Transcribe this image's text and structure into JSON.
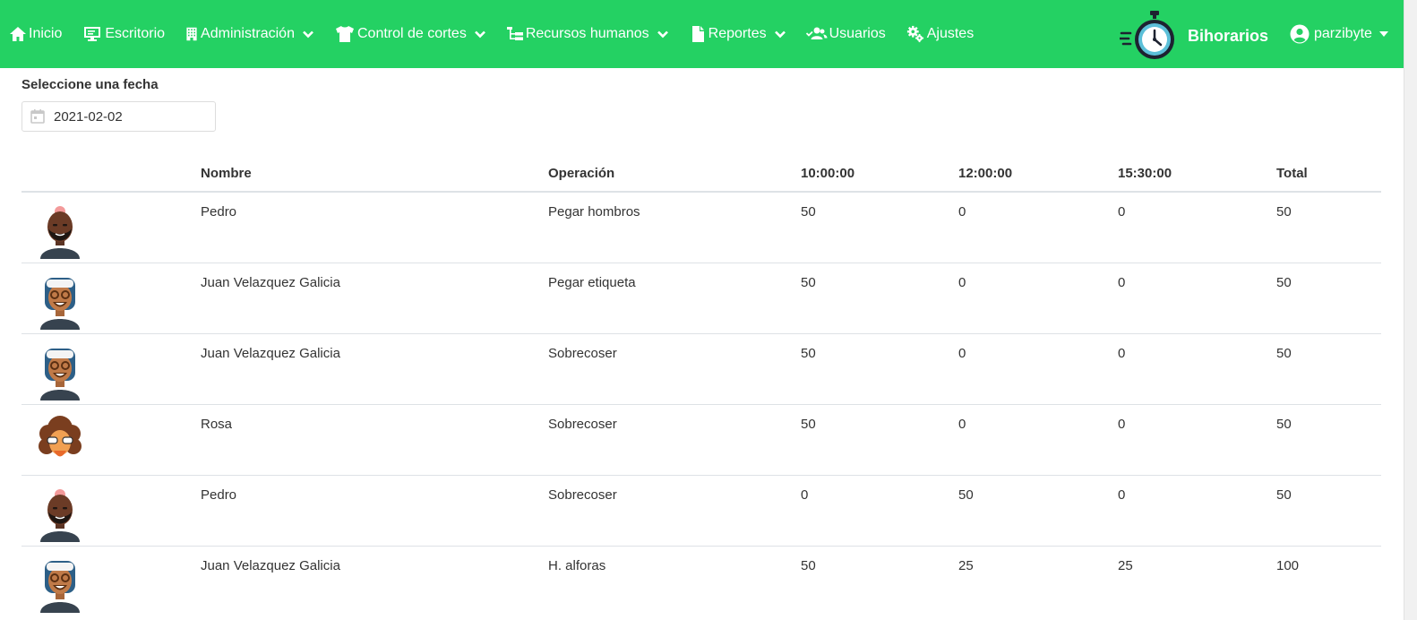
{
  "nav": {
    "items": [
      {
        "label": "Inicio",
        "icon": "home-icon"
      },
      {
        "label": "Escritorio",
        "icon": "desktop-icon"
      },
      {
        "label": "Administración",
        "icon": "building-icon",
        "dropdown": true
      },
      {
        "label": "Control de cortes",
        "icon": "tshirt-icon",
        "dropdown": true
      },
      {
        "label": "Recursos humanos",
        "icon": "sitemap-icon",
        "dropdown": true
      },
      {
        "label": "Reportes",
        "icon": "file-icon",
        "dropdown": true
      },
      {
        "label": "Usuarios",
        "icon": "users-icon"
      },
      {
        "label": "Ajustes",
        "icon": "cogs-icon"
      }
    ],
    "brand": "Bihorarios",
    "user": "parzibyte",
    "accent_color": "#24d163"
  },
  "filter": {
    "label": "Seleccione una fecha",
    "date_value": "2021-02-02"
  },
  "table": {
    "headers": [
      "",
      "Nombre",
      "Operación",
      "10:00:00",
      "12:00:00",
      "15:30:00",
      "Total"
    ],
    "rows": [
      {
        "avatar": "bald-man-avatar",
        "name": "Pedro",
        "operation": "Pegar hombros",
        "h1": "50",
        "h2": "0",
        "h3": "0",
        "total": "50"
      },
      {
        "avatar": "cap-man-avatar",
        "name": "Juan Velazquez Galicia",
        "operation": "Pegar etiqueta",
        "h1": "50",
        "h2": "0",
        "h3": "0",
        "total": "50"
      },
      {
        "avatar": "cap-man-avatar",
        "name": "Juan Velazquez Galicia",
        "operation": "Sobrecoser",
        "h1": "50",
        "h2": "0",
        "h3": "0",
        "total": "50"
      },
      {
        "avatar": "curly-woman-avatar",
        "name": "Rosa",
        "operation": "Sobrecoser",
        "h1": "50",
        "h2": "0",
        "h3": "0",
        "total": "50"
      },
      {
        "avatar": "bald-man-avatar",
        "name": "Pedro",
        "operation": "Sobrecoser",
        "h1": "0",
        "h2": "50",
        "h3": "0",
        "total": "50"
      },
      {
        "avatar": "cap-man-avatar",
        "name": "Juan Velazquez Galicia",
        "operation": "H. alforas",
        "h1": "50",
        "h2": "25",
        "h3": "25",
        "total": "100"
      }
    ]
  }
}
